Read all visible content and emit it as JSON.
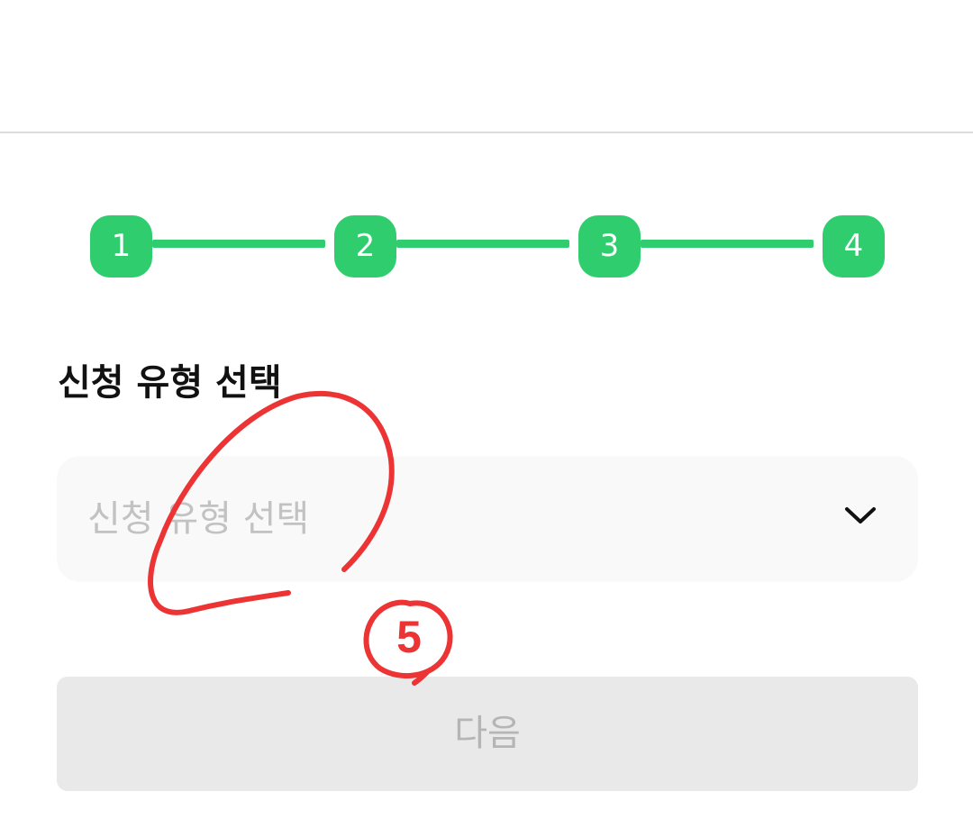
{
  "steps": [
    {
      "label": "1"
    },
    {
      "label": "2"
    },
    {
      "label": "3"
    },
    {
      "label": "4"
    }
  ],
  "section": {
    "title": "신청 유형 선택"
  },
  "select": {
    "placeholder": "신청 유형 선택",
    "icon": "chevron-down-icon"
  },
  "next_button": {
    "label": "다음",
    "enabled": false
  },
  "annotation": {
    "number": "5"
  },
  "colors": {
    "accent": "#2fcd6e",
    "annotation": "#ec3434",
    "title": "#111111",
    "placeholder": "#c2c2c2",
    "disabled_bg": "#e9e9e9",
    "disabled_text": "#b5b5b5",
    "field_bg": "#f9f9f9",
    "divider": "#dcdcdc"
  }
}
